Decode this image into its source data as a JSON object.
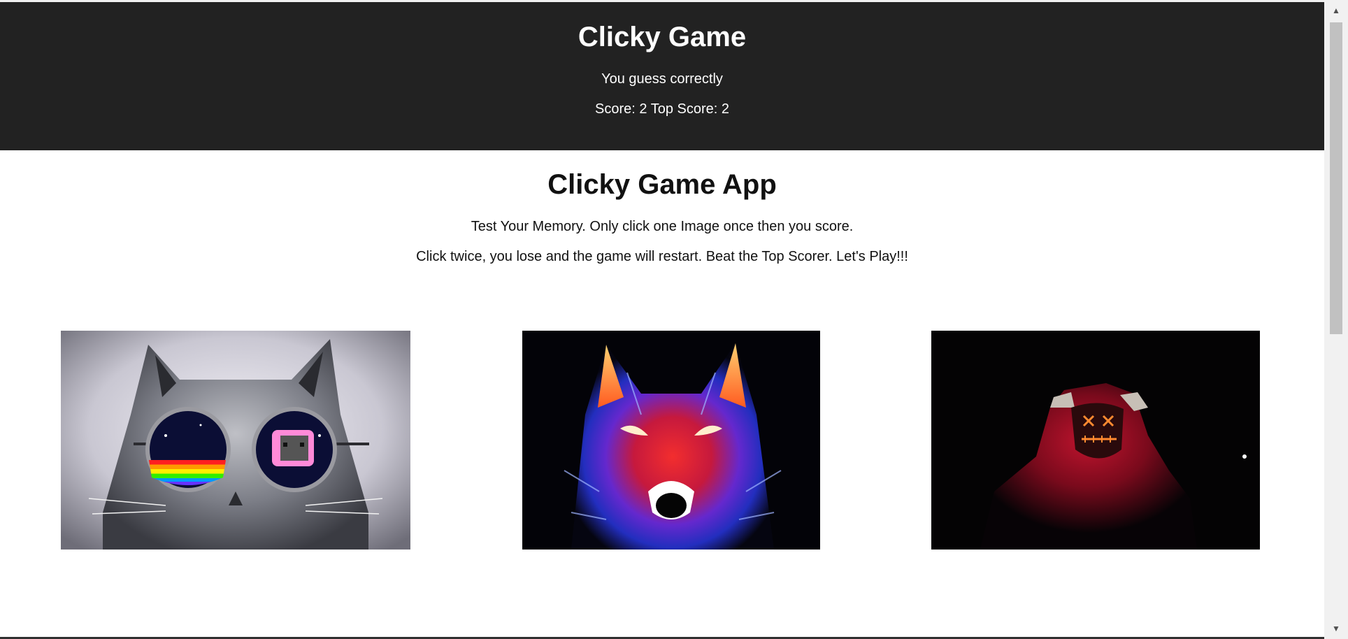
{
  "navbar": {
    "title": "Clicky Game",
    "message": "You guess correctly",
    "score_text": "Score: 2 Top Score: 2"
  },
  "jumbotron": {
    "title": "Clicky Game App",
    "instruction_1": "Test Your Memory. Only click one Image once then you score.",
    "instruction_2": "Click twice, you lose and the game will restart. Beat the Top Scorer. Let's Play!!!"
  },
  "cards": [
    {
      "subject": "cat with rainbow sunglasses"
    },
    {
      "subject": "neon fire wolf"
    },
    {
      "subject": "figure in red hoodie with glowing mask"
    }
  ],
  "colors": {
    "navbar_bg": "#222222",
    "page_bg": "#ffffff",
    "text_light": "#ffffff",
    "text_dark": "#111111"
  },
  "scrollbar": {
    "up_icon": "arrow-up-icon",
    "down_icon": "arrow-down-icon"
  }
}
